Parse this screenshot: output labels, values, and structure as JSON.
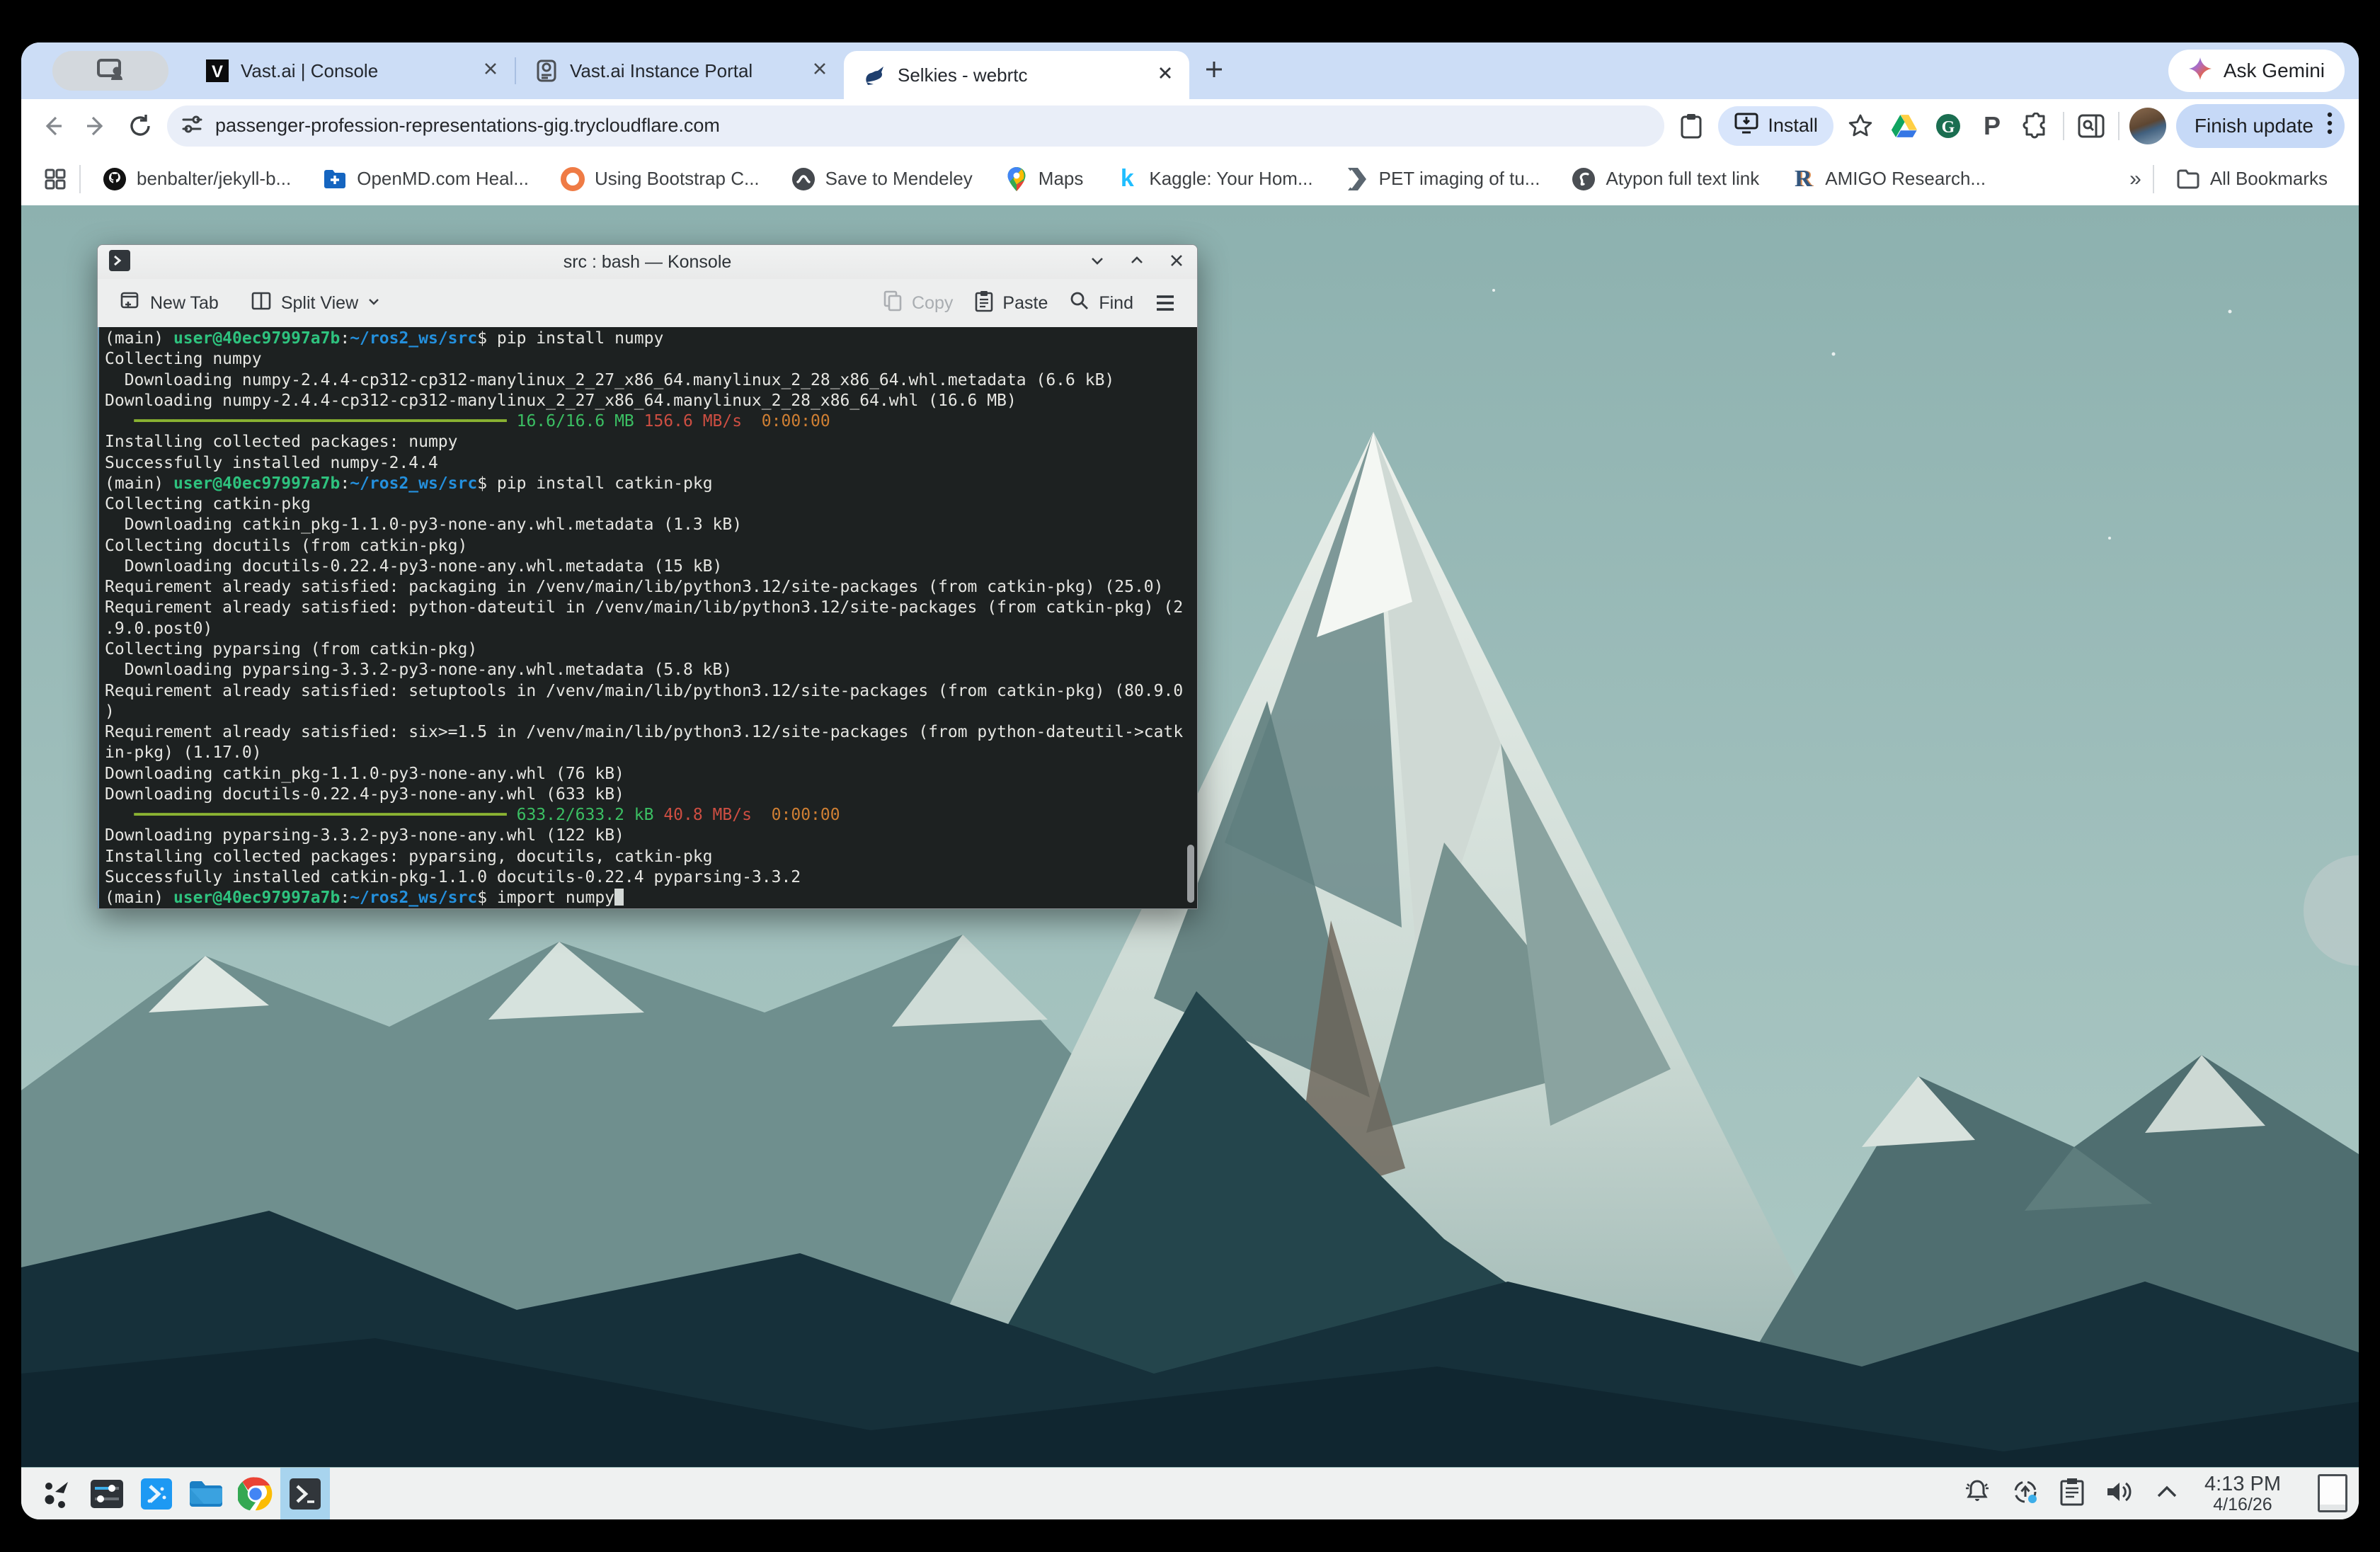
{
  "browser": {
    "tabs": [
      {
        "label": "Vast.ai | Console"
      },
      {
        "label": "Vast.ai Instance Portal"
      },
      {
        "label": "Selkies - webrtc"
      }
    ],
    "ask_gemini_label": "Ask Gemini",
    "url": "passenger-profession-representations-gig.trycloudflare.com",
    "install_label": "Install",
    "finish_update_label": "Finish update",
    "bookmarks": [
      {
        "label": "benbalter/jekyll-b..."
      },
      {
        "label": "OpenMD.com Heal..."
      },
      {
        "label": "Using Bootstrap C..."
      },
      {
        "label": "Save to Mendeley"
      },
      {
        "label": "Maps"
      },
      {
        "label": "Kaggle: Your Hom..."
      },
      {
        "label": "PET imaging of tu..."
      },
      {
        "label": "Atypon full text link"
      },
      {
        "label": "AMIGO Research..."
      }
    ],
    "overflow_glyph": "»",
    "all_bookmarks_label": "All Bookmarks",
    "toolbar_icons": [
      "clipboard-icon",
      "install-icon",
      "bookmark-star-icon",
      "drive-icon",
      "grammarly-icon",
      "p-extension-icon",
      "extensions-puzzle-icon",
      "side-panel-search-icon"
    ],
    "accent_colors": {
      "tabstrip": "#ccddf6",
      "chip": "#d8e5fb",
      "omnibox": "#e9eef8"
    }
  },
  "konsole": {
    "title": "src : bash — Konsole",
    "toolbar": {
      "new_tab": "New Tab",
      "split_view": "Split View",
      "copy": "Copy",
      "paste": "Paste",
      "find": "Find"
    }
  },
  "terminal": {
    "colors": {
      "background": "#1d2121",
      "foreground": "#e6e6e2",
      "user_green": "#2ec27e",
      "path_blue": "#2490dd",
      "bar_green": "#8ab332",
      "done_green": "#3bbf63",
      "speed_red": "#cd4e42",
      "eta_orange": "#cf7f33"
    },
    "prompt_pre": "(main) ",
    "prompt_user": "user@40ec97997a7b",
    "prompt_sep": ":",
    "prompt_path": "~/ros2_ws/src",
    "prompt_dollar": "$ ",
    "cmd_pip_numpy": "pip install numpy",
    "cmd_pip_catkin": "pip install catkin-pkg",
    "cmd_import": "import numpy",
    "out": {
      "collecting_numpy": "Collecting numpy",
      "dl_numpy_meta": "  Downloading numpy-2.4.4-cp312-cp312-manylinux_2_27_x86_64.manylinux_2_28_x86_64.whl.metadata (6.6 kB)",
      "dl_numpy_whl": "Downloading numpy-2.4.4-cp312-cp312-manylinux_2_27_x86_64.manylinux_2_28_x86_64.whl (16.6 MB)",
      "installing_numpy": "Installing collected packages: numpy",
      "installed_numpy": "Successfully installed numpy-2.4.4",
      "collecting_catkin": "Collecting catkin-pkg",
      "dl_catkin_meta": "  Downloading catkin_pkg-1.1.0-py3-none-any.whl.metadata (1.3 kB)",
      "collecting_docutils": "Collecting docutils (from catkin-pkg)",
      "dl_docutils_meta": "  Downloading docutils-0.22.4-py3-none-any.whl.metadata (15 kB)",
      "req_packaging": "Requirement already satisfied: packaging in /venv/main/lib/python3.12/site-packages (from catkin-pkg) (25.0)",
      "req_dateutil_1": "Requirement already satisfied: python-dateutil in /venv/main/lib/python3.12/site-packages (from catkin-pkg) (2",
      "req_dateutil_2": ".9.0.post0)",
      "collecting_pyparsing": "Collecting pyparsing (from catkin-pkg)",
      "dl_pyparsing_meta": "  Downloading pyparsing-3.3.2-py3-none-any.whl.metadata (5.8 kB)",
      "req_setuptools_1": "Requirement already satisfied: setuptools in /venv/main/lib/python3.12/site-packages (from catkin-pkg) (80.9.0",
      "req_setuptools_2": ")",
      "req_six_1": "Requirement already satisfied: six>=1.5 in /venv/main/lib/python3.12/site-packages (from python-dateutil->catk",
      "req_six_2": "in-pkg) (1.17.0)",
      "dl_catkin_whl": "Downloading catkin_pkg-1.1.0-py3-none-any.whl (76 kB)",
      "dl_docutils_whl": "Downloading docutils-0.22.4-py3-none-any.whl (633 kB)",
      "dl_pyparsing_whl": "Downloading pyparsing-3.3.2-py3-none-any.whl (122 kB)",
      "installing_catkin": "Installing collected packages: pyparsing, docutils, catkin-pkg",
      "installed_catkin": "Successfully installed catkin-pkg-1.1.0 docutils-0.22.4 pyparsing-3.3.2"
    },
    "bar1": {
      "spaces": "   ",
      "bar": "━━━━━━━━━━━━━━━━━━━━━━━━━━━━━━━━━━━━━━",
      "done": " 16.6/16.6 MB",
      "speed": " 156.6 MB/s",
      "eta": "  0:00:00"
    },
    "bar2": {
      "spaces": "   ",
      "bar": "━━━━━━━━━━━━━━━━━━━━━━━━━━━━━━━━━━━━━━",
      "done": " 633.2/633.2 kB",
      "speed": " 40.8 MB/s",
      "eta": "  0:00:00"
    }
  },
  "taskbar": {
    "launcher_icons": [
      "app-launcher-icon",
      "system-settings-icon",
      "discover-icon",
      "file-manager-icon",
      "chrome-icon",
      "konsole-icon"
    ],
    "tray_icons": [
      "notifications-bell-icon",
      "updates-icon",
      "clipboard-icon",
      "volume-icon",
      "expand-tray-chevron-icon"
    ],
    "clock_time": "4:13 PM",
    "clock_date": "4/16/26"
  }
}
